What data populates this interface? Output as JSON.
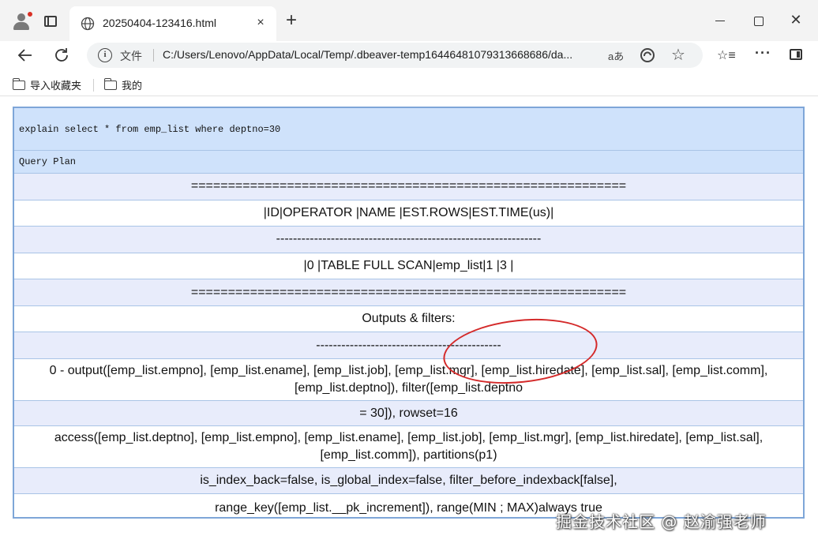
{
  "browser": {
    "tab_title": "20250404-123416.html",
    "close_glyph": "×",
    "newtab_glyph": "+",
    "close_window_glyph": "✕",
    "address": {
      "file_label": "文件",
      "url": "C:/Users/Lenovo/AppData/Local/Temp/.dbeaver-temp16446481079313668686/da...",
      "read_aloud": "aあ"
    },
    "bookmarks": {
      "import_label": "导入收藏夹",
      "mine_label": "我的"
    }
  },
  "plan": {
    "query": "explain select * from emp_list where deptno=30",
    "header": "Query Plan",
    "rows": [
      "===========================================================",
      "|ID|OPERATOR |NAME |EST.ROWS|EST.TIME(us)|",
      "---------------------------------------------------------------",
      "|0 |TABLE FULL SCAN|emp_list|1 |3 |",
      "===========================================================",
      "Outputs & filters:",
      "--------------------------------------------",
      "0 - output([emp_list.empno], [emp_list.ename], [emp_list.job], [emp_list.mgr], [emp_list.hiredate], [emp_list.sal], [emp_list.comm], [emp_list.deptno]), filter([emp_list.deptno",
      "= 30]), rowset=16",
      "access([emp_list.deptno], [emp_list.empno], [emp_list.ename], [emp_list.job], [emp_list.mgr], [emp_list.hiredate], [emp_list.sal], [emp_list.comm]), partitions(p1)",
      "is_index_back=false, is_global_index=false, filter_before_indexback[false],",
      "range_key([emp_list.__pk_increment]), range(MIN ; MAX)always true"
    ]
  },
  "watermark": "掘金技术社区 @ 赵渝强老师",
  "colors": {
    "accent_border": "#7ea6d8",
    "header_row": "#cfe2fb",
    "alt_row": "#e8ecfb",
    "annotation_ring": "#d42a2a"
  }
}
